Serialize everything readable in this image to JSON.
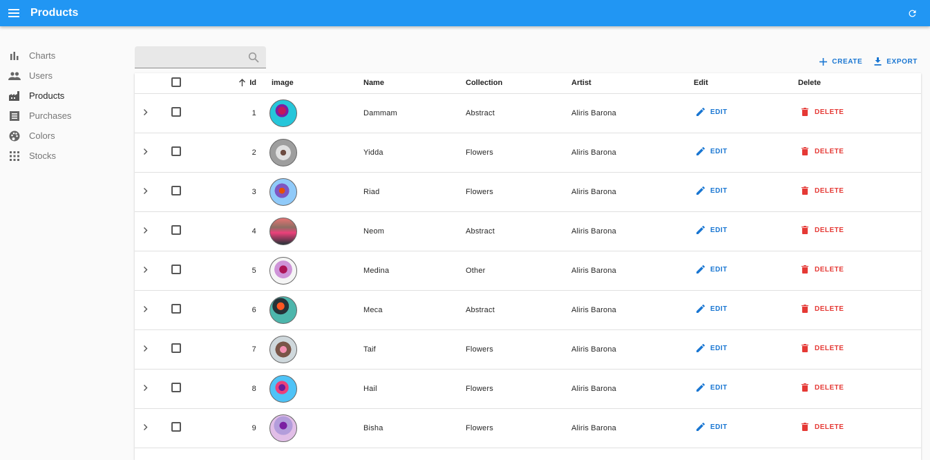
{
  "app": {
    "title": "Products",
    "menu_icon": "menu-icon",
    "refresh_icon": "refresh-icon"
  },
  "sidebar": {
    "items": [
      {
        "label": "Charts",
        "icon": "bar-chart-icon"
      },
      {
        "label": "Users",
        "icon": "people-icon"
      },
      {
        "label": "Products",
        "icon": "factory-icon",
        "active": true
      },
      {
        "label": "Purchases",
        "icon": "receipt-icon"
      },
      {
        "label": "Colors",
        "icon": "palette-icon"
      },
      {
        "label": "Stocks",
        "icon": "grid-icon"
      }
    ]
  },
  "search": {
    "placeholder": "",
    "value": ""
  },
  "toolbar": {
    "create_label": "CREATE",
    "export_label": "EXPORT"
  },
  "table": {
    "columns": {
      "id": "Id",
      "image": "image",
      "name": "Name",
      "collection": "Collection",
      "artist": "Artist",
      "edit": "Edit",
      "delete": "Delete"
    },
    "edit_label": "EDIT",
    "delete_label": "DELETE",
    "rows": [
      {
        "id": "1",
        "name": "Dammam",
        "collection": "Abstract",
        "artist": "Aliris Barona"
      },
      {
        "id": "2",
        "name": "Yidda",
        "collection": "Flowers",
        "artist": "Aliris Barona"
      },
      {
        "id": "3",
        "name": "Riad",
        "collection": "Flowers",
        "artist": "Aliris Barona"
      },
      {
        "id": "4",
        "name": "Neom",
        "collection": "Abstract",
        "artist": "Aliris Barona"
      },
      {
        "id": "5",
        "name": "Medina",
        "collection": "Other",
        "artist": "Aliris Barona"
      },
      {
        "id": "6",
        "name": "Meca",
        "collection": "Abstract",
        "artist": "Aliris Barona"
      },
      {
        "id": "7",
        "name": "Taif",
        "collection": "Flowers",
        "artist": "Aliris Barona"
      },
      {
        "id": "8",
        "name": "Hail",
        "collection": "Flowers",
        "artist": "Aliris Barona"
      },
      {
        "id": "9",
        "name": "Bisha",
        "collection": "Flowers",
        "artist": "Aliris Barona"
      }
    ]
  },
  "colors": {
    "primary": "#2196f3",
    "accent": "#1976d2",
    "danger": "#e53935"
  }
}
